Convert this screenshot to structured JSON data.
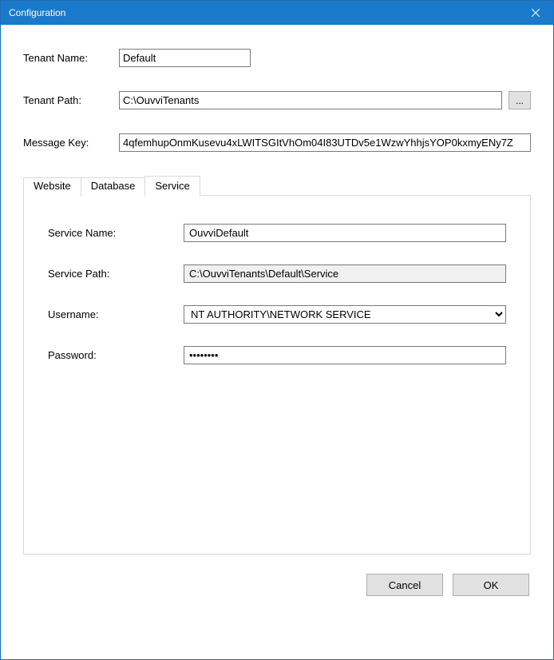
{
  "window": {
    "title": "Configuration"
  },
  "form": {
    "tenant_name_label": "Tenant Name:",
    "tenant_name_value": "Default",
    "tenant_path_label": "Tenant Path:",
    "tenant_path_value": "C:\\OuvviTenants",
    "browse_label": "...",
    "message_key_label": "Message Key:",
    "message_key_value": "4qfemhupOnmKusevu4xLWITSGItVhOm04I83UTDv5e1WzwYhhjsYOP0kxmyENy7Z"
  },
  "tabs": {
    "website": "Website",
    "database": "Database",
    "service": "Service"
  },
  "service_panel": {
    "service_name_label": "Service Name:",
    "service_name_value": "OuvviDefault",
    "service_path_label": "Service Path:",
    "service_path_value": "C:\\OuvviTenants\\Default\\Service",
    "username_label": "Username:",
    "username_value": "NT AUTHORITY\\NETWORK SERVICE",
    "password_label": "Password:",
    "password_value": "••••••••"
  },
  "buttons": {
    "cancel": "Cancel",
    "ok": "OK"
  }
}
